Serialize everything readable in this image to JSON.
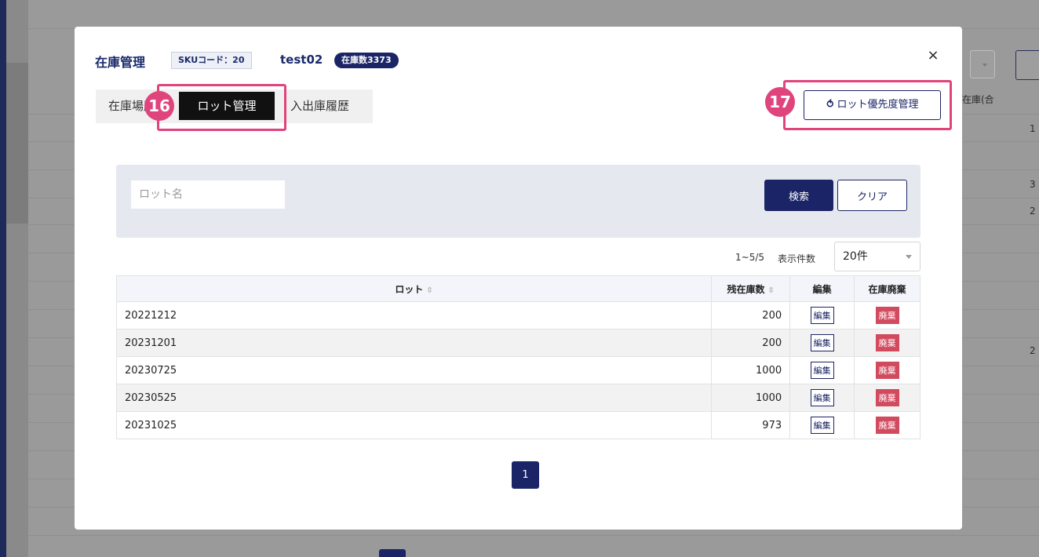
{
  "background": {
    "header_label": "在庫(合",
    "row_numbers": [
      "1",
      "3",
      "2",
      "2"
    ]
  },
  "modal": {
    "title": "在庫管理",
    "sku_tag": "SKUコード：20",
    "product_name": "test02",
    "stock_badge": "在庫数3373",
    "close_icon": "×",
    "tabs": [
      {
        "label": "在庫場所管理"
      },
      {
        "label": "ロット管理"
      },
      {
        "label": "入出庫履歴"
      }
    ],
    "callouts": [
      "16",
      "17"
    ],
    "priority_button": {
      "icon": "⥀",
      "label": "ロット優先度管理"
    },
    "search": {
      "placeholder": "ロット名",
      "search_label": "検索",
      "clear_label": "クリア"
    },
    "pagination_info": {
      "range": "1~5/5",
      "per_page_label": "表示件数",
      "per_page_value": "20件"
    },
    "table": {
      "headers": {
        "lot": "ロット",
        "stock": "残在庫数",
        "edit": "編集",
        "dispose": "在庫廃棄"
      },
      "sort_icon": "⇳",
      "rows": [
        {
          "lot": "20221212",
          "stock": "200",
          "edit": "編集",
          "dispose": "廃棄"
        },
        {
          "lot": "20231201",
          "stock": "200",
          "edit": "編集",
          "dispose": "廃棄"
        },
        {
          "lot": "20230725",
          "stock": "1000",
          "edit": "編集",
          "dispose": "廃棄"
        },
        {
          "lot": "20230525",
          "stock": "1000",
          "edit": "編集",
          "dispose": "廃棄"
        },
        {
          "lot": "20231025",
          "stock": "973",
          "edit": "編集",
          "dispose": "廃棄"
        }
      ]
    },
    "pagination": {
      "current_page": "1"
    }
  },
  "colors": {
    "brand_navy": "#1b2466",
    "callout_pink": "#e0447c",
    "dispose_red": "#d24a5e"
  }
}
